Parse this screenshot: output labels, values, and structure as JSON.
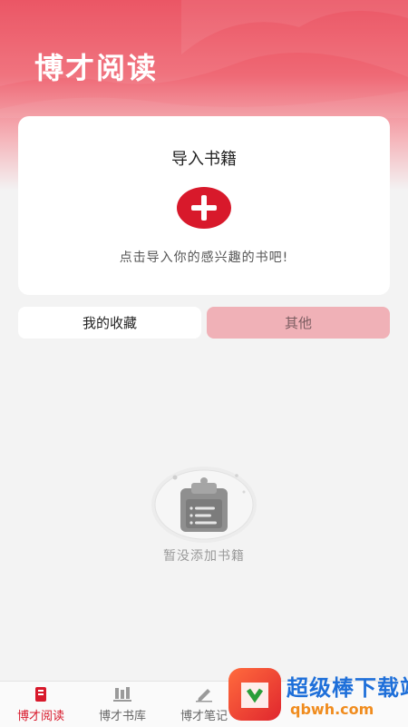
{
  "header": {
    "app_title": "博才阅读"
  },
  "import_card": {
    "title": "导入书籍",
    "add_icon": "plus-icon",
    "hint": "点击导入你的感兴趣的书吧!"
  },
  "tabs": [
    {
      "label": "我的收藏",
      "active": true
    },
    {
      "label": "其他",
      "active": false
    }
  ],
  "empty_state": {
    "icon": "clipboard-icon",
    "text": "暂没添加书籍"
  },
  "bottom_nav": [
    {
      "label": "博才阅读",
      "icon": "book-icon",
      "active": true
    },
    {
      "label": "博才书库",
      "icon": "bookshelf-icon",
      "active": false
    },
    {
      "label": "博才笔记",
      "icon": "pen-icon",
      "active": false
    }
  ],
  "watermark": {
    "title": "超级棒下载站",
    "url": "qbwh.com"
  },
  "colors": {
    "accent": "#d8192b",
    "header": "#ea4a5a",
    "tab_inactive": "#f0b1b7"
  }
}
